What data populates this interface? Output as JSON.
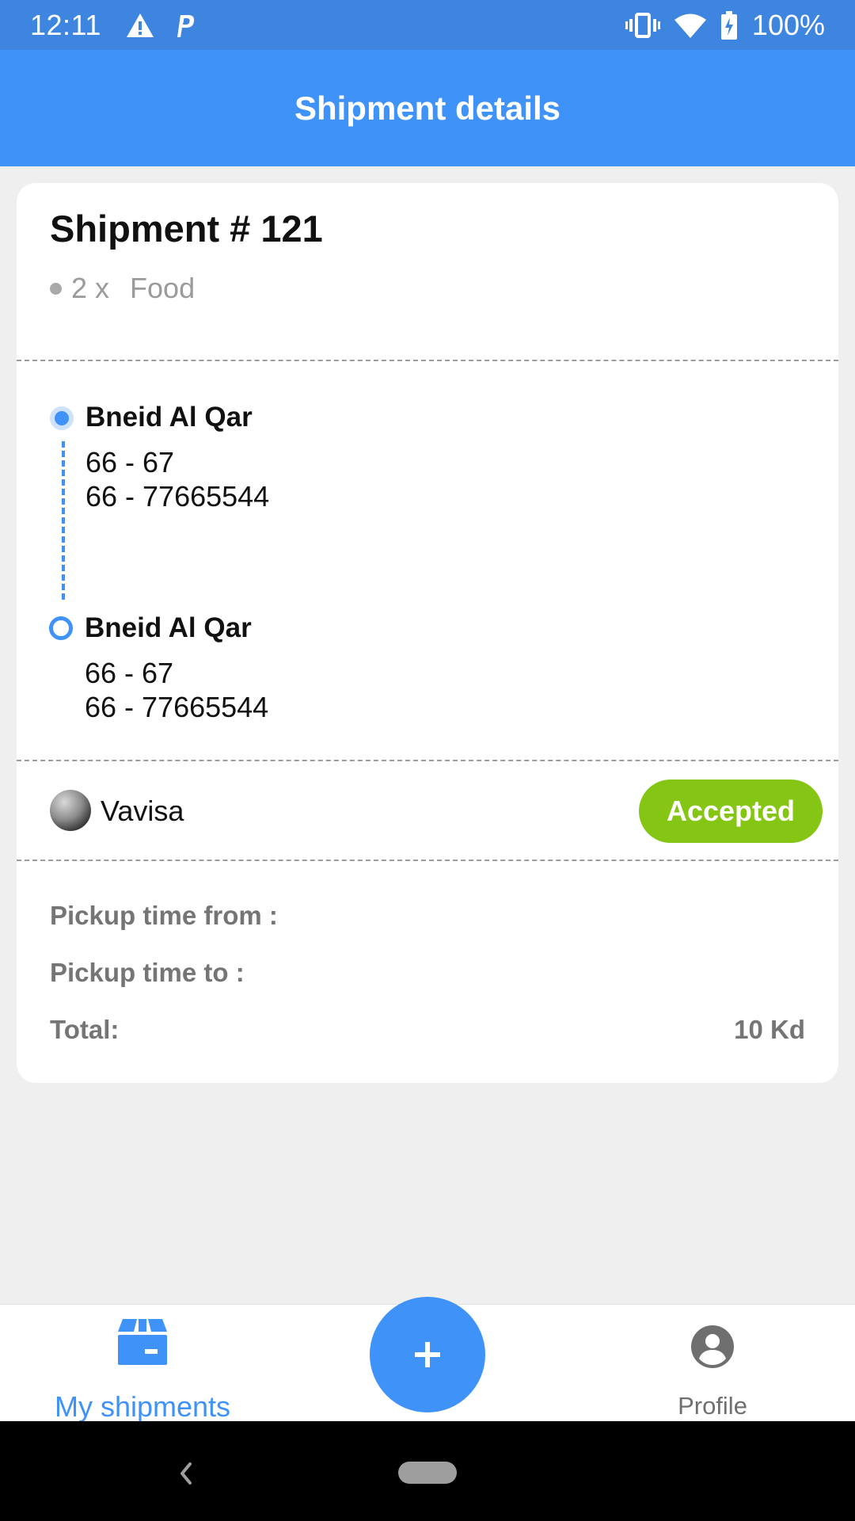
{
  "status_bar": {
    "time": "12:11",
    "battery": "100%",
    "icons": [
      "alert-icon",
      "parking-icon",
      "vibrate-icon",
      "wifi-icon",
      "battery-charging-icon"
    ]
  },
  "app_bar": {
    "title": "Shipment details"
  },
  "shipment": {
    "title": "Shipment # 121",
    "items": [
      {
        "qty": "2 x",
        "name": "Food"
      }
    ],
    "pickup": {
      "area": "Bneid Al Qar",
      "address": "66 - 67",
      "phone": "66 - 77665544"
    },
    "dropoff": {
      "area": "Bneid Al Qar",
      "address": "66 - 67",
      "phone": "66 - 77665544"
    },
    "driver": {
      "name": "Vavisa"
    },
    "status": {
      "label": "Accepted",
      "color": "#85c614"
    },
    "pickup_time_from_label": "Pickup time from :",
    "pickup_time_to_label": "Pickup time to :",
    "total_label": "Total:",
    "total_value": "10 Kd"
  },
  "bottom_nav": {
    "items": [
      {
        "label": "My shipments",
        "icon": "box-icon",
        "active": true
      },
      {
        "label": "Profile",
        "icon": "account-circle-icon",
        "active": false
      }
    ],
    "fab_icon": "plus-icon"
  },
  "colors": {
    "primary": "#3f92f7",
    "status_bar": "#3d85de",
    "accepted": "#85c614"
  }
}
